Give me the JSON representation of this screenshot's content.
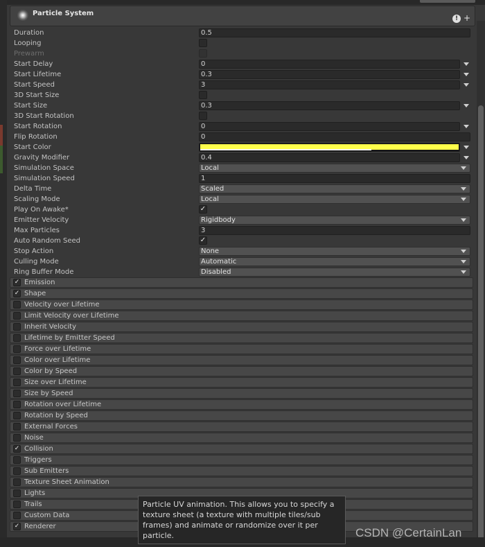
{
  "header": {
    "title": "Particle System",
    "help_glyph": "!",
    "add_glyph": "+"
  },
  "check_glyph": "✓",
  "colors": {
    "start_color_swatch": "#ffff4a",
    "panel_bg": "#383838",
    "module_bg": "#474747"
  },
  "props": [
    {
      "label": "Duration",
      "kind": "text",
      "value": "0.5"
    },
    {
      "label": "Looping",
      "kind": "check",
      "checked": false
    },
    {
      "label": "Prewarm",
      "kind": "check",
      "checked": false,
      "disabled": true
    },
    {
      "label": "Start Delay",
      "kind": "curve",
      "value": "0"
    },
    {
      "label": "Start Lifetime",
      "kind": "curve",
      "value": "0.3"
    },
    {
      "label": "Start Speed",
      "kind": "curve",
      "value": "3"
    },
    {
      "label": "3D Start Size",
      "kind": "check",
      "checked": false
    },
    {
      "label": "Start Size",
      "kind": "curve",
      "value": "0.3"
    },
    {
      "label": "3D Start Rotation",
      "kind": "check",
      "checked": false
    },
    {
      "label": "Start Rotation",
      "kind": "curve",
      "value": "0"
    },
    {
      "label": "Flip Rotation",
      "kind": "text",
      "value": "0"
    },
    {
      "label": "Start Color",
      "kind": "color",
      "value": "#ffff4a"
    },
    {
      "label": "Gravity Modifier",
      "kind": "curve",
      "value": "0.4"
    },
    {
      "label": "Simulation Space",
      "kind": "dropdown",
      "value": "Local"
    },
    {
      "label": "Simulation Speed",
      "kind": "text",
      "value": "1"
    },
    {
      "label": "Delta Time",
      "kind": "dropdown",
      "value": "Scaled"
    },
    {
      "label": "Scaling Mode",
      "kind": "dropdown",
      "value": "Local"
    },
    {
      "label": "Play On Awake*",
      "kind": "check",
      "checked": true
    },
    {
      "label": "Emitter Velocity",
      "kind": "dropdown",
      "value": "Rigidbody"
    },
    {
      "label": "Max Particles",
      "kind": "text",
      "value": "3"
    },
    {
      "label": "Auto Random Seed",
      "kind": "check",
      "checked": true
    },
    {
      "label": "Stop Action",
      "kind": "dropdown",
      "value": "None"
    },
    {
      "label": "Culling Mode",
      "kind": "dropdown",
      "value": "Automatic"
    },
    {
      "label": "Ring Buffer Mode",
      "kind": "dropdown",
      "value": "Disabled"
    }
  ],
  "modules": [
    {
      "label": "Emission",
      "enabled": true
    },
    {
      "label": "Shape",
      "enabled": true
    },
    {
      "label": "Velocity over Lifetime",
      "enabled": false
    },
    {
      "label": "Limit Velocity over Lifetime",
      "enabled": false
    },
    {
      "label": "Inherit Velocity",
      "enabled": false
    },
    {
      "label": "Lifetime by Emitter Speed",
      "enabled": false
    },
    {
      "label": "Force over Lifetime",
      "enabled": false
    },
    {
      "label": "Color over Lifetime",
      "enabled": false
    },
    {
      "label": "Color by Speed",
      "enabled": false
    },
    {
      "label": "Size over Lifetime",
      "enabled": false
    },
    {
      "label": "Size by Speed",
      "enabled": false
    },
    {
      "label": "Rotation over Lifetime",
      "enabled": false
    },
    {
      "label": "Rotation by Speed",
      "enabled": false
    },
    {
      "label": "External Forces",
      "enabled": false
    },
    {
      "label": "Noise",
      "enabled": false
    },
    {
      "label": "Collision",
      "enabled": true
    },
    {
      "label": "Triggers",
      "enabled": false
    },
    {
      "label": "Sub Emitters",
      "enabled": false
    },
    {
      "label": "Texture Sheet Animation",
      "enabled": false
    },
    {
      "label": "Lights",
      "enabled": false
    },
    {
      "label": "Trails",
      "enabled": false
    },
    {
      "label": "Custom Data",
      "enabled": false
    },
    {
      "label": "Renderer",
      "enabled": true
    }
  ],
  "tooltip": "Particle UV animation. This allows you to specify a texture sheet (a texture with multiple tiles/sub frames) and animate or randomize over it per particle.",
  "watermark": "CSDN @CertainLan"
}
